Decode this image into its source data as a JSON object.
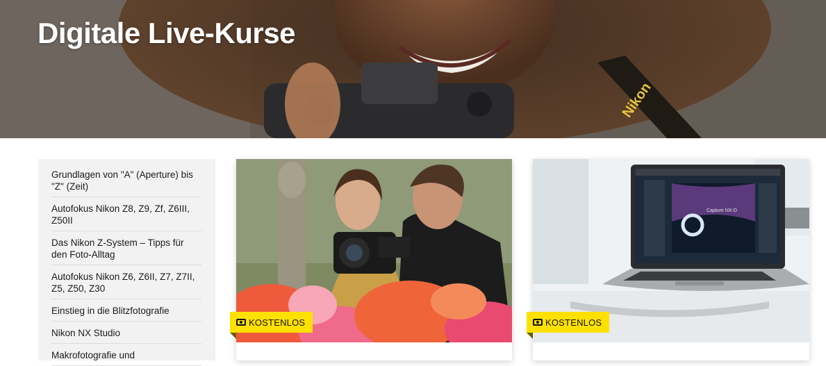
{
  "hero": {
    "title": "Digitale Live-Kurse"
  },
  "sidebar": {
    "items": [
      {
        "label": "Grundlagen von \"A\" (Aperture) bis \"Z\" (Zeit)"
      },
      {
        "label": "Autofokus Nikon Z8, Z9, Zf, Z6III, Z50II"
      },
      {
        "label": "Das Nikon Z-System – Tipps für den Foto-Alltag"
      },
      {
        "label": "Autofokus Nikon Z6, Z6II, Z7, Z7II, Z5, Z50, Z30"
      },
      {
        "label": "Einstieg in die Blitzfotografie"
      },
      {
        "label": "Nikon NX Studio"
      },
      {
        "label": "Makrofotografie und"
      }
    ]
  },
  "cards": [
    {
      "badge": "KOSTENLOS"
    },
    {
      "badge": "KOSTENLOS"
    }
  ],
  "colors": {
    "badge": "#ffe100",
    "sidebar_bg": "#f2f2f2"
  }
}
